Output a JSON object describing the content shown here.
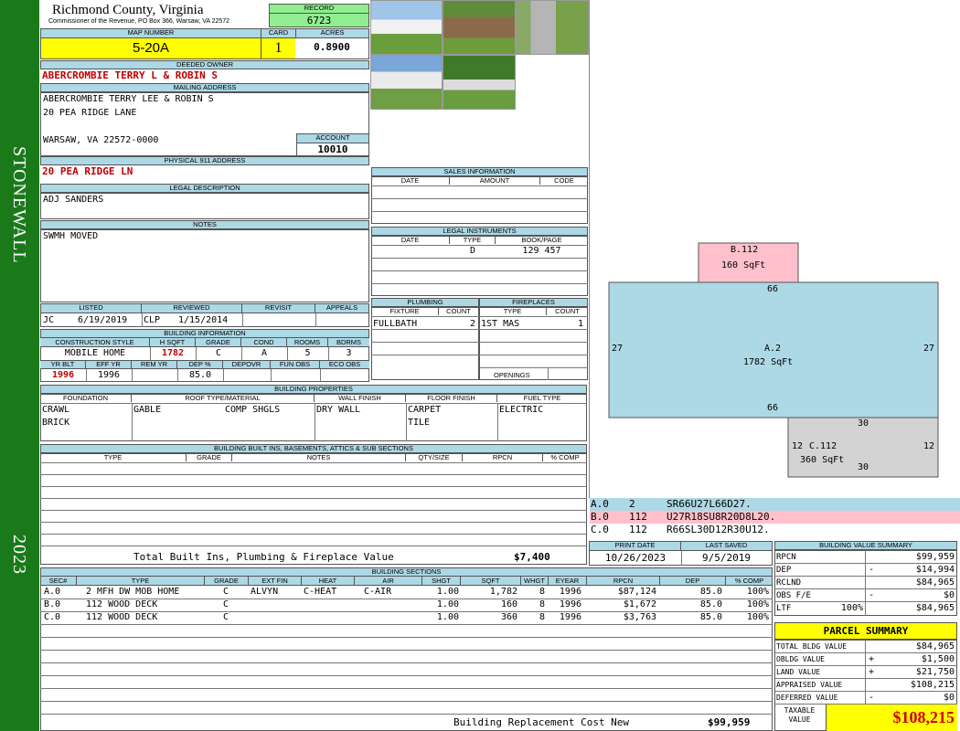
{
  "sidebar": {
    "district": "STONEWALL",
    "year": "2023"
  },
  "header": {
    "county": "Richmond County, Virginia",
    "commissioner": "Commissioner of the Revenue, PO Box 366, Warsaw, VA 22572",
    "record_label": "RECORD",
    "record": "6723",
    "map_label": "MAP NUMBER",
    "map": "5-20A",
    "card_label": "CARD",
    "card": "1",
    "acres_label": "ACRES",
    "acres": "0.8900"
  },
  "owner": {
    "deeded_label": "DEEDED OWNER",
    "deeded": "ABERCROMBIE TERRY L & ROBIN S",
    "mailing_label": "MAILING ADDRESS",
    "mail1": "ABERCROMBIE TERRY LEE & ROBIN S",
    "mail2": "20 PEA RIDGE LANE",
    "mail3": "WARSAW, VA 22572-0000",
    "account_label": "ACCOUNT",
    "account": "10010",
    "phys_label": "PHYSICAL 911 ADDRESS",
    "phys": "20 PEA RIDGE LN",
    "legal_label": "LEGAL DESCRIPTION",
    "legal": "ADJ SANDERS",
    "notes_label": "NOTES",
    "notes": "SWMH MOVED"
  },
  "review": {
    "listed_label": "LISTED",
    "reviewed_label": "REVIEWED",
    "revisit_label": "REVISIT",
    "appeals_label": "APPEALS",
    "listed_by": "JC",
    "listed_date": "6/19/2019",
    "reviewed_by": "CLP",
    "reviewed_date": "1/15/2014"
  },
  "building_info": {
    "label": "BUILDING INFORMATION",
    "h": [
      "CONSTRUCTION STYLE",
      "H SQFT",
      "GRADE",
      "COND",
      "ROOMS",
      "BDRMS"
    ],
    "v": [
      "MOBILE HOME",
      "1782",
      "C",
      "A",
      "5",
      "3"
    ],
    "h2": [
      "YR BLT",
      "EFF YR",
      "REM YR",
      "DEP %",
      "DEPOVR",
      "FUN OBS",
      "ECO OBS"
    ],
    "v2": [
      "1996",
      "1996",
      "",
      "85.0",
      "",
      "",
      ""
    ]
  },
  "sales": {
    "label": "SALES INFORMATION",
    "h": [
      "DATE",
      "AMOUNT",
      "CODE"
    ]
  },
  "legal_instr": {
    "label": "LEGAL INSTRUMENTS",
    "h": [
      "DATE",
      "TYPE",
      "BOOK/PAGE"
    ],
    "type": "D",
    "book": "129 457"
  },
  "plumbing": {
    "label": "PLUMBING",
    "h": [
      "FIXTURE",
      "COUNT"
    ],
    "fixture": "FULLBATH",
    "count": "2"
  },
  "fireplaces": {
    "label": "FIREPLACES",
    "h": [
      "TYPE",
      "COUNT"
    ],
    "type": "1ST MAS",
    "count": "1",
    "openings_label": "OPENINGS"
  },
  "properties": {
    "label": "BUILDING PROPERTIES",
    "h": [
      "FOUNDATION",
      "ROOF TYPE/MATERIAL",
      "WALL FINISH",
      "FLOOR FINISH",
      "FUEL TYPE"
    ],
    "foundation1": "CRAWL",
    "foundation2": "BRICK",
    "roof_type": "GABLE",
    "roof_mat": "COMP SHGLS",
    "wall": "DRY WALL",
    "floor1": "CARPET",
    "floor2": "TILE",
    "fuel": "ELECTRIC"
  },
  "builtins": {
    "label": "BUILDING BUILT INS, BASEMENTS, ATTICS & SUB SECTIONS",
    "h": [
      "TYPE",
      "GRADE",
      "NOTES",
      "QTY/SIZE",
      "RPCN",
      "% COMP"
    ],
    "total_label": "Total Built Ins, Plumbing & Fireplace Value",
    "total": "$7,400"
  },
  "dates": {
    "print_label": "PRINT DATE",
    "print": "10/26/2023",
    "saved_label": "LAST SAVED",
    "saved": "9/5/2019"
  },
  "sections": {
    "label": "BUILDING SECTIONS",
    "h": [
      "SEC#",
      "TYPE",
      "GRADE",
      "EXT FIN",
      "HEAT",
      "AIR",
      "SHGT",
      "SQFT",
      "WHGT",
      "EYEAR",
      "RPCN",
      "DEP",
      "% COMP"
    ],
    "rows": [
      [
        "A.0",
        "2 MFH DW MOB HOME",
        "C",
        "ALVYN",
        "C-HEAT",
        "C-AIR",
        "1.00",
        "1,782",
        "8",
        "1996",
        "$87,124",
        "85.0",
        "100%"
      ],
      [
        "B.0",
        "112 WOOD DECK",
        "C",
        "",
        "",
        "",
        "1.00",
        "160",
        "8",
        "1996",
        "$1,672",
        "85.0",
        "100%"
      ],
      [
        "C.0",
        "112 WOOD DECK",
        "C",
        "",
        "",
        "",
        "1.00",
        "360",
        "8",
        "1996",
        "$3,763",
        "85.0",
        "100%"
      ]
    ],
    "brcn_label": "Building Replacement Cost New",
    "brcn": "$99,959"
  },
  "sketch": {
    "b_label": "B.112",
    "b_area": "160 SqFt",
    "a_label": "A.2",
    "a_area": "1782 SqFt",
    "c_label": "C.112",
    "c_area": "360 SqFt",
    "a_top": "66",
    "a_bottom": "66",
    "a_left": "27",
    "a_right": "27",
    "c_top": "30",
    "c_bottom": "30",
    "c_left": "12",
    "c_right": "12",
    "codes": [
      {
        "sec": "A.0",
        "code": "2",
        "vec": "SR66U27L66D27.",
        "color": "#add8e6"
      },
      {
        "sec": "B.0",
        "code": "112",
        "vec": "U27R18SU8R20D8L20.",
        "color": "#ffc0cb"
      },
      {
        "sec": "C.0",
        "code": "112",
        "vec": "R66SL30D12R30U12.",
        "color": "#ffffff"
      }
    ]
  },
  "bvs": {
    "label": "BUILDING VALUE SUMMARY",
    "rows": [
      {
        "k": "RPCN",
        "s": "",
        "v": "$99,959"
      },
      {
        "k": "DEP",
        "s": "-",
        "v": "$14,994"
      },
      {
        "k": "RCLND",
        "s": "",
        "v": "$84,965"
      },
      {
        "k": "OBS F/E",
        "s": "-",
        "v": "$0"
      },
      {
        "k": "LTF",
        "s": "100%",
        "v": "$84,965"
      }
    ]
  },
  "parcel": {
    "label": "PARCEL SUMMARY",
    "rows": [
      {
        "k": "TOTAL BLDG VALUE",
        "s": "",
        "v": "$84,965"
      },
      {
        "k": "OBLDG VALUE",
        "s": "+",
        "v": "$1,500"
      },
      {
        "k": "LAND VALUE",
        "s": "+",
        "v": "$21,750"
      },
      {
        "k": "APPRAISED VALUE",
        "s": "",
        "v": "$108,215"
      },
      {
        "k": "DEFERRED VALUE",
        "s": "-",
        "v": "$0"
      }
    ],
    "taxable_label": "TAXABLE VALUE",
    "taxable": "$108,215"
  }
}
